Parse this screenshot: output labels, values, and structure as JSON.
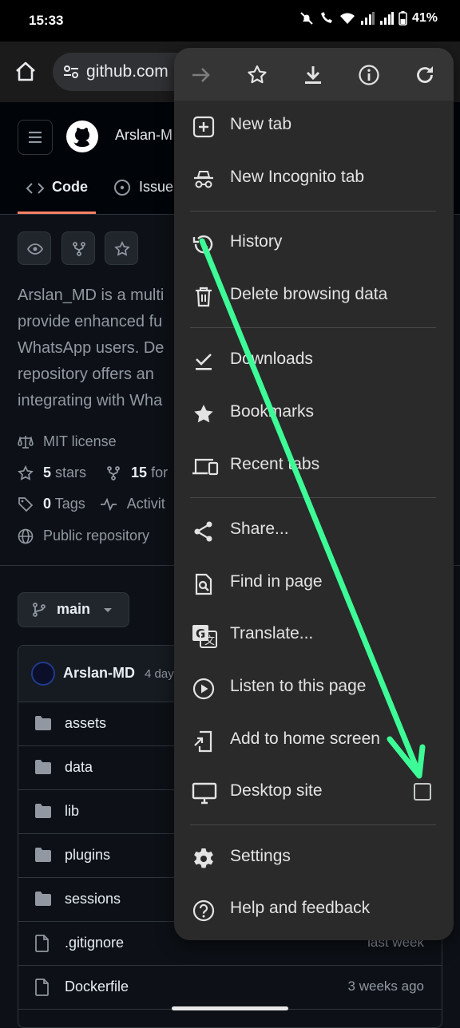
{
  "status": {
    "time": "15:33",
    "battery": "41%"
  },
  "browser": {
    "url": "github.com"
  },
  "github": {
    "owner": "Arslan-M",
    "tabs": {
      "code": "Code",
      "issues": "Issue"
    },
    "about_lines": [
      "Arslan_MD is a multi",
      "provide enhanced fu",
      "WhatsApp users. De",
      "repository offers an",
      "integrating with Wha"
    ],
    "license": "MIT license",
    "stars_count": "5",
    "stars_label": "stars",
    "forks_count": "15",
    "forks_label": "for",
    "tags_count": "0",
    "tags_label": "Tags",
    "activity_label": "Activit",
    "visibility": "Public repository",
    "branch": "main",
    "commit_author": "Arslan-MD",
    "commit_time": "4 day",
    "files": [
      {
        "name": "assets",
        "type": "folder",
        "ago": ""
      },
      {
        "name": "data",
        "type": "folder",
        "ago": ""
      },
      {
        "name": "lib",
        "type": "folder",
        "ago": ""
      },
      {
        "name": "plugins",
        "type": "folder",
        "ago": ""
      },
      {
        "name": "sessions",
        "type": "folder",
        "ago": ""
      },
      {
        "name": ".gitignore",
        "type": "file",
        "ago": "last week"
      },
      {
        "name": "Dockerfile",
        "type": "file",
        "ago": "3 weeks ago"
      }
    ]
  },
  "menu": {
    "toolbar_icons": [
      "forward-icon",
      "bookmark-star-icon",
      "download-icon",
      "info-icon",
      "refresh-icon"
    ],
    "items": [
      {
        "label": "New tab",
        "icon": "plus-square-icon"
      },
      {
        "label": "New Incognito tab",
        "icon": "incognito-icon"
      },
      {
        "label": "History",
        "icon": "history-icon"
      },
      {
        "label": "Delete browsing data",
        "icon": "trash-icon"
      },
      {
        "label": "Downloads",
        "icon": "downloads-icon"
      },
      {
        "label": "Bookmarks",
        "icon": "star-icon"
      },
      {
        "label": "Recent tabs",
        "icon": "devices-icon"
      },
      {
        "label": "Share...",
        "icon": "share-icon"
      },
      {
        "label": "Find in page",
        "icon": "find-icon"
      },
      {
        "label": "Translate...",
        "icon": "translate-icon"
      },
      {
        "label": "Listen to this page",
        "icon": "play-icon"
      },
      {
        "label": "Add to home screen",
        "icon": "add-home-icon"
      },
      {
        "label": "Desktop site",
        "icon": "monitor-icon"
      },
      {
        "label": "Settings",
        "icon": "gear-icon"
      },
      {
        "label": "Help and feedback",
        "icon": "help-icon"
      }
    ],
    "desktop_site_checked": false
  },
  "annotation": {
    "arrow_color": "#3dfc97"
  }
}
